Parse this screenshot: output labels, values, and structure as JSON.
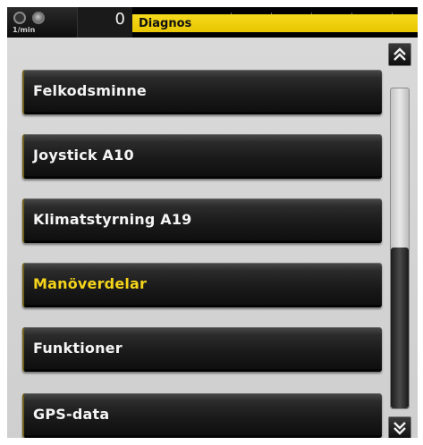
{
  "status_bar": {
    "rpm_unit": "1/min",
    "counter_value": "0",
    "screen_title": "Diagnos"
  },
  "menu": {
    "items": [
      {
        "label": "Felkodsminne",
        "active": false
      },
      {
        "label": "Joystick A10",
        "active": false
      },
      {
        "label": "Klimatstyrning A19",
        "active": false
      },
      {
        "label": "Manöverdelar",
        "active": true
      },
      {
        "label": "Funktioner",
        "active": false
      },
      {
        "label": "GPS-data",
        "active": false
      }
    ]
  },
  "scrollbar": {
    "up_icon": "double-chevron-up-icon",
    "down_icon": "double-chevron-down-icon",
    "thumb_position": 0.5
  },
  "colors": {
    "title_strip": "#f2d20f",
    "active_label": "#f5d41b",
    "item_label": "#f4f4f4",
    "list_background": "#d6d6d6"
  }
}
